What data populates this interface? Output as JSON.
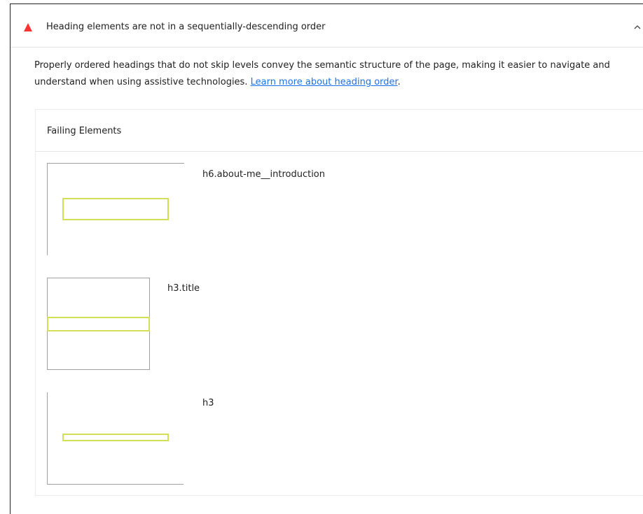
{
  "audit": {
    "title": "Heading elements are not in a sequentially-descending order",
    "description_text": "Properly ordered headings that do not skip levels convey the semantic structure of the page, making it easier to navigate and understand when using assistive technologies. ",
    "learn_more_link": "Learn more about heading order",
    "description_suffix": ".",
    "status_icon": "fail-triangle-icon",
    "toggle_icon": "chevron-up-icon",
    "status_color": "#ff3333",
    "link_color": "#1a73e8"
  },
  "table": {
    "header": "Failing Elements",
    "highlight_color": "#d4df58",
    "rows": [
      {
        "selector": "h6.about-me__introduction"
      },
      {
        "selector": "h3.title"
      },
      {
        "selector": "h3"
      }
    ]
  }
}
